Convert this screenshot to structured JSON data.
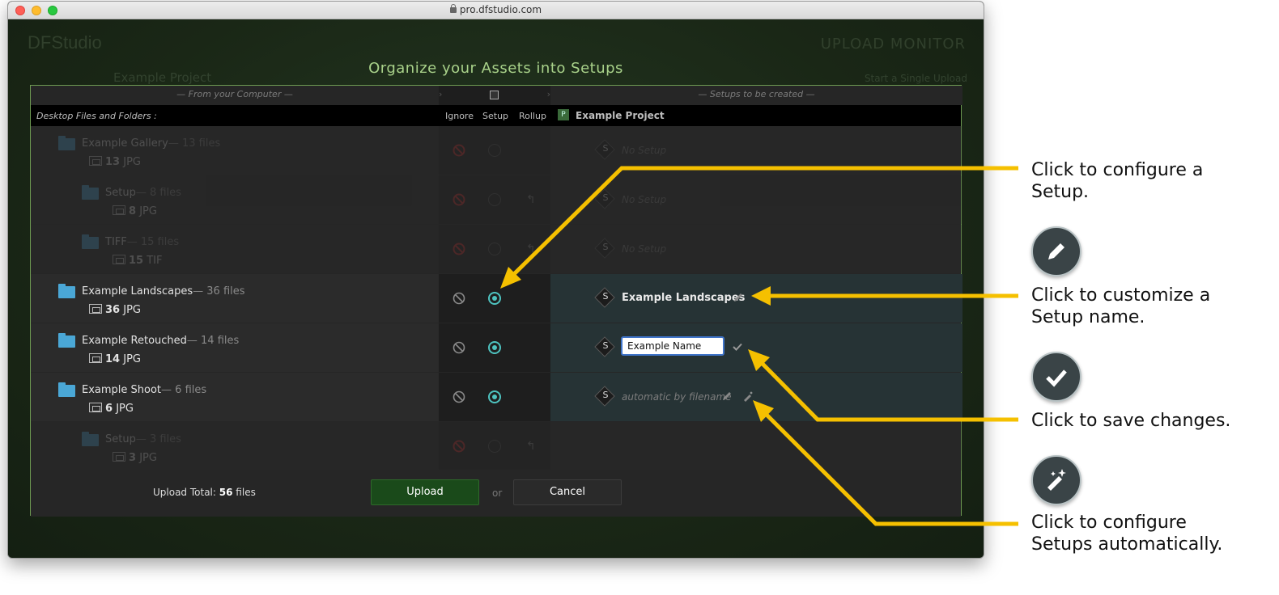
{
  "window": {
    "url": "pro.dfstudio.com",
    "brand": "DFStudio",
    "upload_monitor": "UPLOAD MONITOR",
    "breadcrumb": "Example Project",
    "single_upload": "Start a Single Upload"
  },
  "dialog": {
    "title": "Organize your Assets into Setups",
    "left_subheader": "— From your Computer —",
    "right_subheader": "— Setups to be created —",
    "left_header": "Desktop Files and Folders :",
    "col_ignore": "Ignore",
    "col_setup": "Setup",
    "col_rollup": "Rollup",
    "project_badge": "P",
    "project_name": "Example Project"
  },
  "rows": [
    {
      "name": "Example Gallery",
      "count": "— 13 files",
      "sub_num": "13",
      "sub_type": "JPG",
      "right": "No Setup"
    },
    {
      "name": "Setup",
      "count": "— 8 files",
      "sub_num": "8",
      "sub_type": "JPG",
      "right": "No Setup"
    },
    {
      "name": "TIFF",
      "count": "— 15 files",
      "sub_num": "15",
      "sub_type": "TIF",
      "right": "No Setup"
    },
    {
      "name": "Example Landscapes",
      "count": "— 36 files",
      "sub_num": "36",
      "sub_type": "JPG",
      "right": "Example Landscapes"
    },
    {
      "name": "Example Retouched",
      "count": "— 14 files",
      "sub_num": "14",
      "sub_type": "JPG",
      "input_value": "Example Name"
    },
    {
      "name": "Example Shoot",
      "count": "— 6 files",
      "sub_num": "6",
      "sub_type": "JPG",
      "right": "automatic by filename"
    },
    {
      "name": "Setup",
      "count": "— 3 files",
      "sub_num": "3",
      "sub_type": "JPG",
      "right": ""
    }
  ],
  "setup_letter": "S",
  "footer": {
    "total_label": "Upload Total:",
    "total_num": "56",
    "total_unit": "files",
    "upload": "Upload",
    "or": "or",
    "cancel": "Cancel"
  },
  "annotations": {
    "configure": [
      "Click to configure a",
      "Setup."
    ],
    "customize": [
      "Click to customize a",
      "Setup name."
    ],
    "save": "Click to save changes.",
    "auto": [
      "Click to configure",
      "Setups automatically."
    ]
  },
  "colors": {
    "accent": "#f5c000",
    "setup_on": "#4ec3c0",
    "upload_green": "#1a4a1a"
  }
}
